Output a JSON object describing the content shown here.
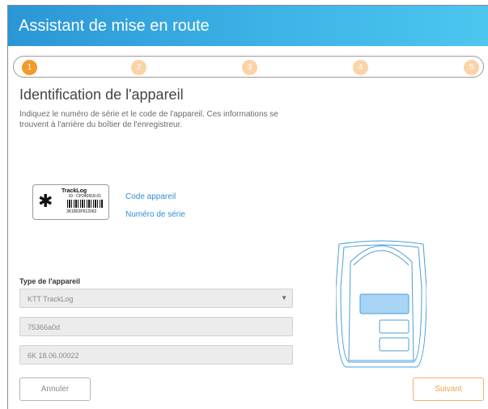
{
  "header": {
    "title": "Assistant de mise en route"
  },
  "stepper": {
    "steps": [
      "1",
      "2",
      "3",
      "4",
      "5"
    ],
    "active_step": 1
  },
  "page": {
    "title": "Identification de l'appareil",
    "description": "Indiquez le numéro de série et le code de l'appareil. Ces informations se trouvent à l'arrière du boîtier de l'enregistreur."
  },
  "label_card": {
    "brand": "TrackLog",
    "id_text": "ID : CP240918-01",
    "serial_text": "3K1802P612062"
  },
  "links": {
    "device_code": "Code appareil",
    "serial_number": "Numéro de série"
  },
  "form": {
    "type_label": "Type de l'appareil",
    "type_value": "KTT TrackLog",
    "device_code_value": "75366a0d",
    "serial_value": "6K 18.06.00022"
  },
  "buttons": {
    "cancel": "Annuler",
    "next": "Suivant"
  },
  "colors": {
    "accent": "#f39a2b",
    "step_inactive": "#fbd3a6",
    "link": "#2f8fd5",
    "header": "#3db3e6"
  },
  "icons": [
    "bluetooth-icon",
    "chevron-down-icon"
  ]
}
